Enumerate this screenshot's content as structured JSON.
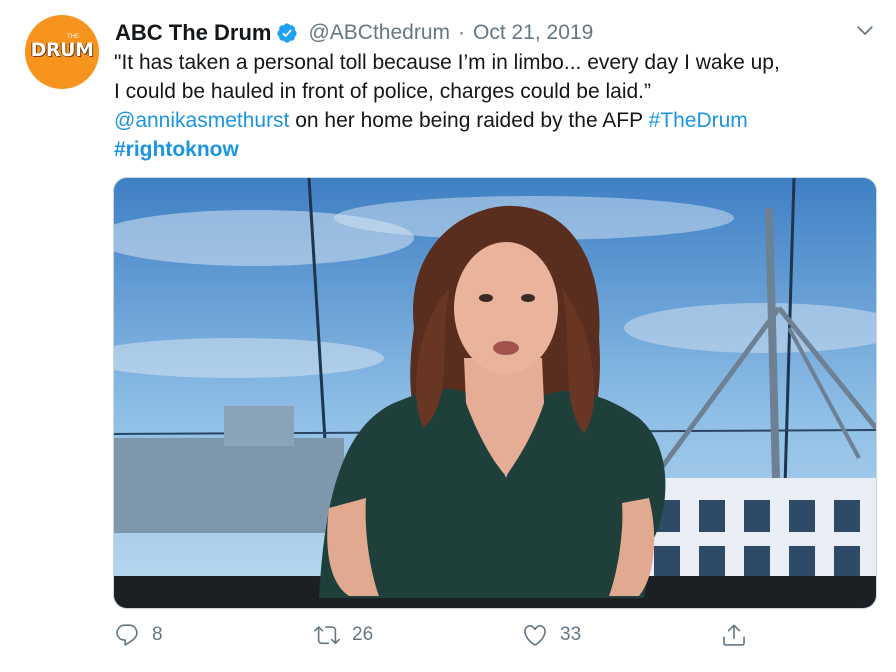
{
  "tweet": {
    "author_name": "ABC The Drum",
    "handle": "@ABCthedrum",
    "separator": "·",
    "date": "Oct 21, 2019",
    "avatar_text": "DRUM",
    "avatar_subtext": "THE",
    "body_line1": "\"It has taken a personal toll because I’m in limbo... every day I wake up,",
    "body_line2": "I could be hauled in front of police, charges could be laid.”",
    "mention": "@annikasmethurst",
    "body_line3": " on her home being raided by the AFP ",
    "hashtag1": "#TheDrum",
    "hashtag2": "#rightoknow"
  },
  "actions": {
    "reply_count": "8",
    "retweet_count": "26",
    "like_count": "33"
  },
  "icons": [
    "verified-badge-icon",
    "chevron-down-icon",
    "reply-icon",
    "retweet-icon",
    "like-icon",
    "share-icon"
  ],
  "colors": {
    "link": "#1b95e0",
    "muted": "#657786",
    "avatar": "#f7941d",
    "text": "#14171a"
  }
}
